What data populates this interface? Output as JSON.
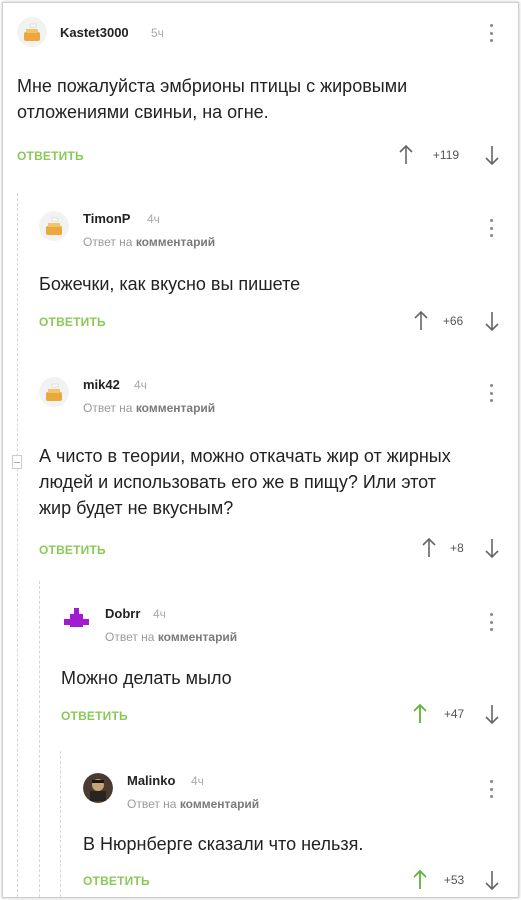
{
  "comments": [
    {
      "username": "Kastet3000",
      "time": "5ч",
      "reply_meta": "",
      "text": "Мне пожалуйста эмбрионы птицы с жировыми отложениями свиньи, на огне.",
      "reply_label": "ОТВЕТИТЬ",
      "score": "+119"
    },
    {
      "username": "TimonP",
      "time": "4ч",
      "reply_meta_prefix": "Ответ на",
      "reply_meta_link": "комментарий",
      "text": "Божечки, как вкусно вы пишете",
      "reply_label": "ОТВЕТИТЬ",
      "score": "+66"
    },
    {
      "username": "mik42",
      "time": "4ч",
      "reply_meta_prefix": "Ответ на",
      "reply_meta_link": "комментарий",
      "text": "А чисто в теории, можно откачать жир от жирных людей и использовать его же в пищу? Или этот жир будет не вкусным?",
      "reply_label": "ОТВЕТИТЬ",
      "score": "+8"
    },
    {
      "username": "Dobrr",
      "time": "4ч",
      "reply_meta_prefix": "Ответ на",
      "reply_meta_link": "комментарий",
      "text": "Можно делать мыло",
      "reply_label": "ОТВЕТИТЬ",
      "score": "+47"
    },
    {
      "username": "Malinko",
      "time": "4ч",
      "reply_meta_prefix": "Ответ на",
      "reply_meta_link": "комментарий",
      "text": "В Нюрнберге сказали что нельзя.",
      "reply_label": "ОТВЕТИТЬ",
      "score": "+53"
    }
  ],
  "icons": {
    "upvote": "arrow-up-icon",
    "downvote": "arrow-down-icon",
    "menu": "kebab-menu-icon"
  },
  "colors": {
    "accent_green": "#8ac858",
    "upvoted_green": "#5fb536",
    "muted": "#9a9a9a"
  }
}
